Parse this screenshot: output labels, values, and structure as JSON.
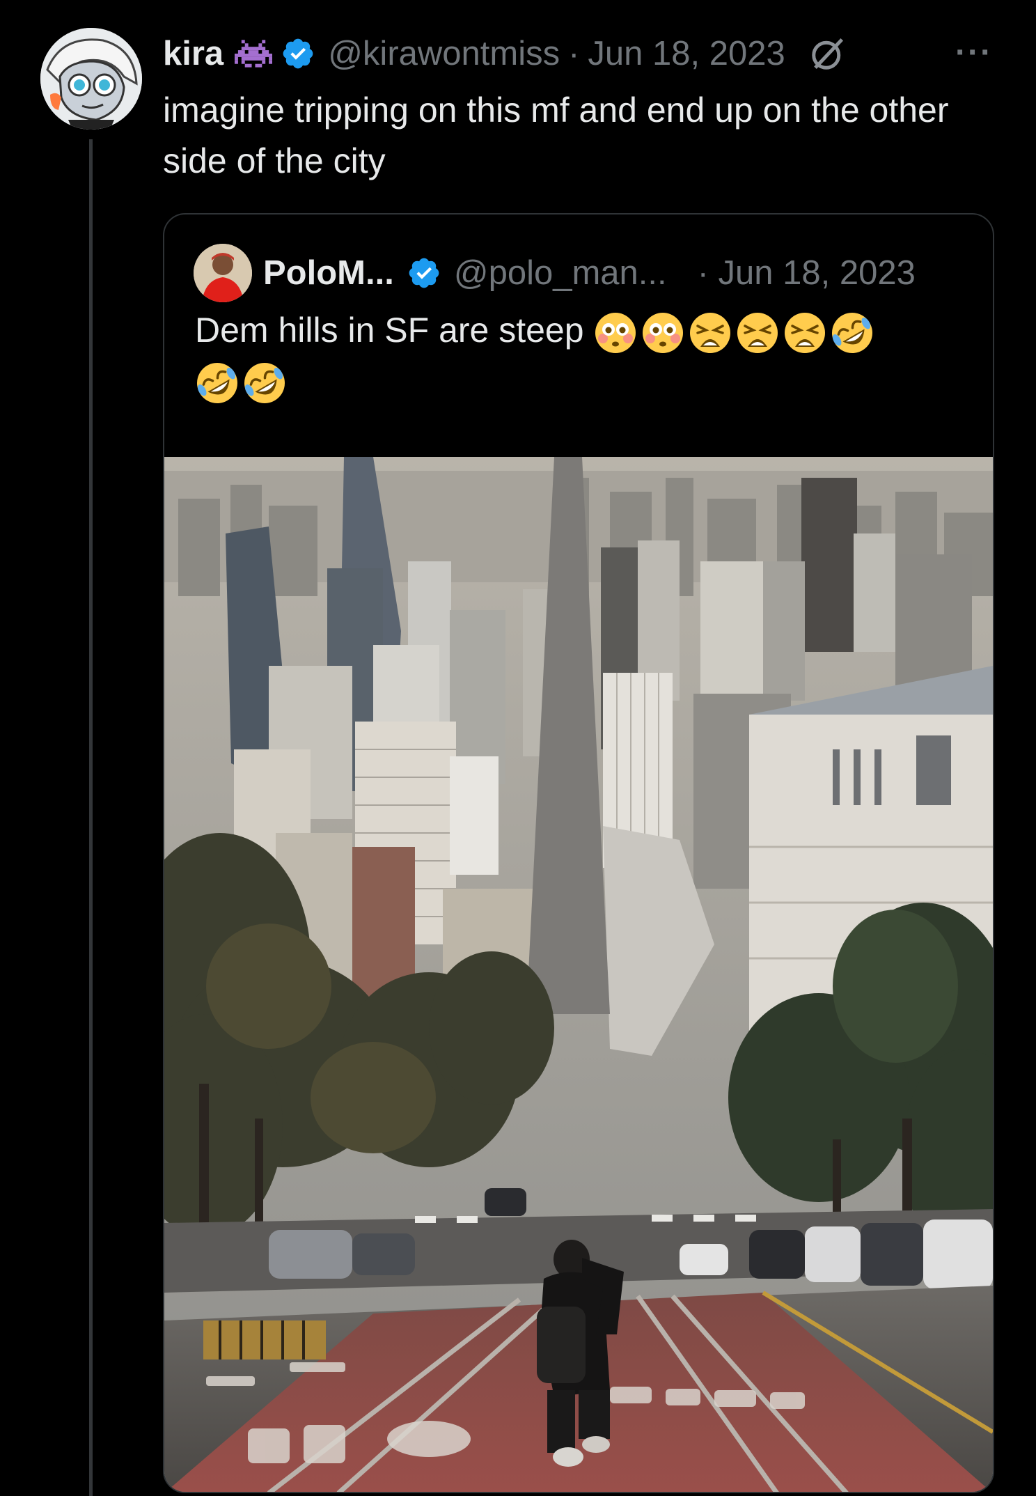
{
  "tweet": {
    "display_name": "kira",
    "handle": "@kirawontmiss",
    "separator": "·",
    "date": "Jun 18, 2023",
    "more_label": "···",
    "text": "imagine tripping on this mf and end up on the other side of the city"
  },
  "quote": {
    "display_name": "PoloM...",
    "handle": "@polo_man...",
    "date": "· Jun 18, 2023",
    "text": "Dem hills in SF are steep",
    "emojis": [
      "flushed-face",
      "flushed-face",
      "weary-face",
      "weary-face",
      "weary-face",
      "rofl-face",
      "rofl-face",
      "rofl-face"
    ]
  },
  "colors": {
    "background": "#000000",
    "text_primary": "#e7e9ea",
    "text_secondary": "#71767b",
    "verified_blue": "#1d9bf0",
    "border": "#2f3336",
    "invader_purple": "#a46fd0"
  }
}
